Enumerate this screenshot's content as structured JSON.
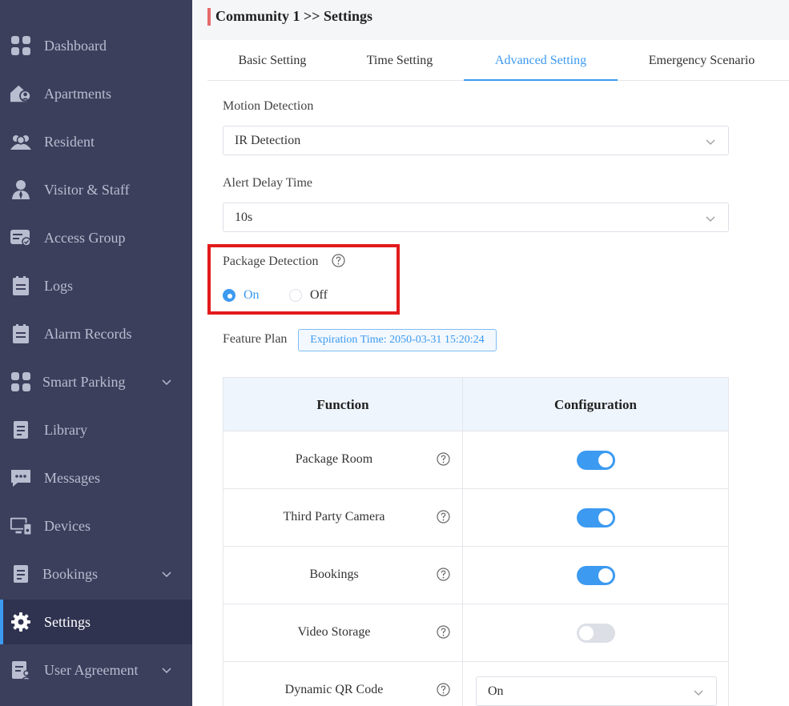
{
  "sidebar": {
    "items": [
      {
        "label": "Dashboard",
        "icon": "dashboard-icon"
      },
      {
        "label": "Apartments",
        "icon": "apartments-icon"
      },
      {
        "label": "Resident",
        "icon": "resident-icon"
      },
      {
        "label": "Visitor & Staff",
        "icon": "visitor-staff-icon"
      },
      {
        "label": "Access Group",
        "icon": "access-group-icon"
      },
      {
        "label": "Logs",
        "icon": "logs-icon"
      },
      {
        "label": "Alarm Records",
        "icon": "alarm-records-icon"
      },
      {
        "label": "Smart Parking",
        "icon": "smart-parking-icon",
        "expandable": true
      },
      {
        "label": "Library",
        "icon": "library-icon"
      },
      {
        "label": "Messages",
        "icon": "messages-icon"
      },
      {
        "label": "Devices",
        "icon": "devices-icon"
      },
      {
        "label": "Bookings",
        "icon": "bookings-icon",
        "expandable": true
      },
      {
        "label": "Settings",
        "icon": "settings-icon",
        "active": true
      },
      {
        "label": "User Agreement",
        "icon": "user-agreement-icon",
        "expandable": true
      }
    ]
  },
  "header": {
    "title": "Community 1 >>  Settings"
  },
  "tabs": [
    {
      "label": "Basic Setting"
    },
    {
      "label": "Time Setting"
    },
    {
      "label": "Advanced Setting",
      "active": true
    },
    {
      "label": "Emergency Scenario"
    }
  ],
  "form": {
    "motion_detection": {
      "label": "Motion Detection",
      "value": "IR Detection"
    },
    "alert_delay": {
      "label": "Alert Delay Time",
      "value": "10s"
    },
    "package_detection": {
      "label": "Package Detection",
      "on_label": "On",
      "off_label": "Off",
      "selected": "On"
    },
    "feature_plan": {
      "label": "Feature Plan",
      "badge": "Expiration Time: 2050-03-31 15:20:24"
    }
  },
  "table": {
    "headers": [
      "Function",
      "Configuration"
    ],
    "rows": [
      {
        "function": "Package Room",
        "control": "toggle",
        "enabled": true
      },
      {
        "function": "Third Party Camera",
        "control": "toggle",
        "enabled": true
      },
      {
        "function": "Bookings",
        "control": "toggle",
        "enabled": true
      },
      {
        "function": "Video Storage",
        "control": "toggle",
        "enabled": false
      },
      {
        "function": "Dynamic QR Code",
        "control": "select",
        "value": "On"
      }
    ]
  },
  "colors": {
    "sidebar_bg": "#3b3f5c",
    "accent": "#3c9af0",
    "highlight_border": "#e21b1b"
  }
}
